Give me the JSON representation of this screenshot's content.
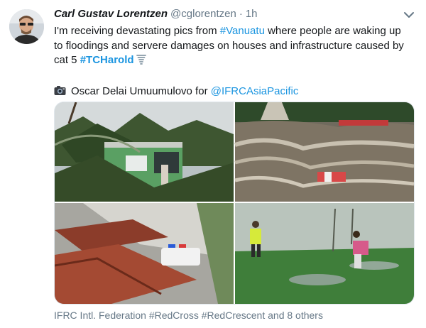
{
  "tweet": {
    "display_name": "Carl Gustav Lorentzen",
    "handle": "@cglorentzen",
    "separator": "·",
    "time": "1h",
    "text_lines": [
      [
        "I'm receiving devastating pics from ",
        "#Vanuatu",
        " where people are waking up"
      ],
      "to floodings and servere damages on houses and infrastructure caused by",
      [
        "cat 5 ",
        "#TCHarold"
      ]
    ],
    "photo_credit": {
      "prefix": "Oscar Delai Umuumulovo for ",
      "mention": "@IFRCAsiaPacific"
    },
    "tagged": "IFRC Intl. Federation #RedCross #RedCrescent and 8 others"
  },
  "icons": {
    "caret": "chevron-down-icon",
    "tornado": "tornado-icon",
    "camera": "camera-icon"
  },
  "colors": {
    "link": "#1b95e0",
    "muted": "#657786",
    "text": "#14171a"
  }
}
